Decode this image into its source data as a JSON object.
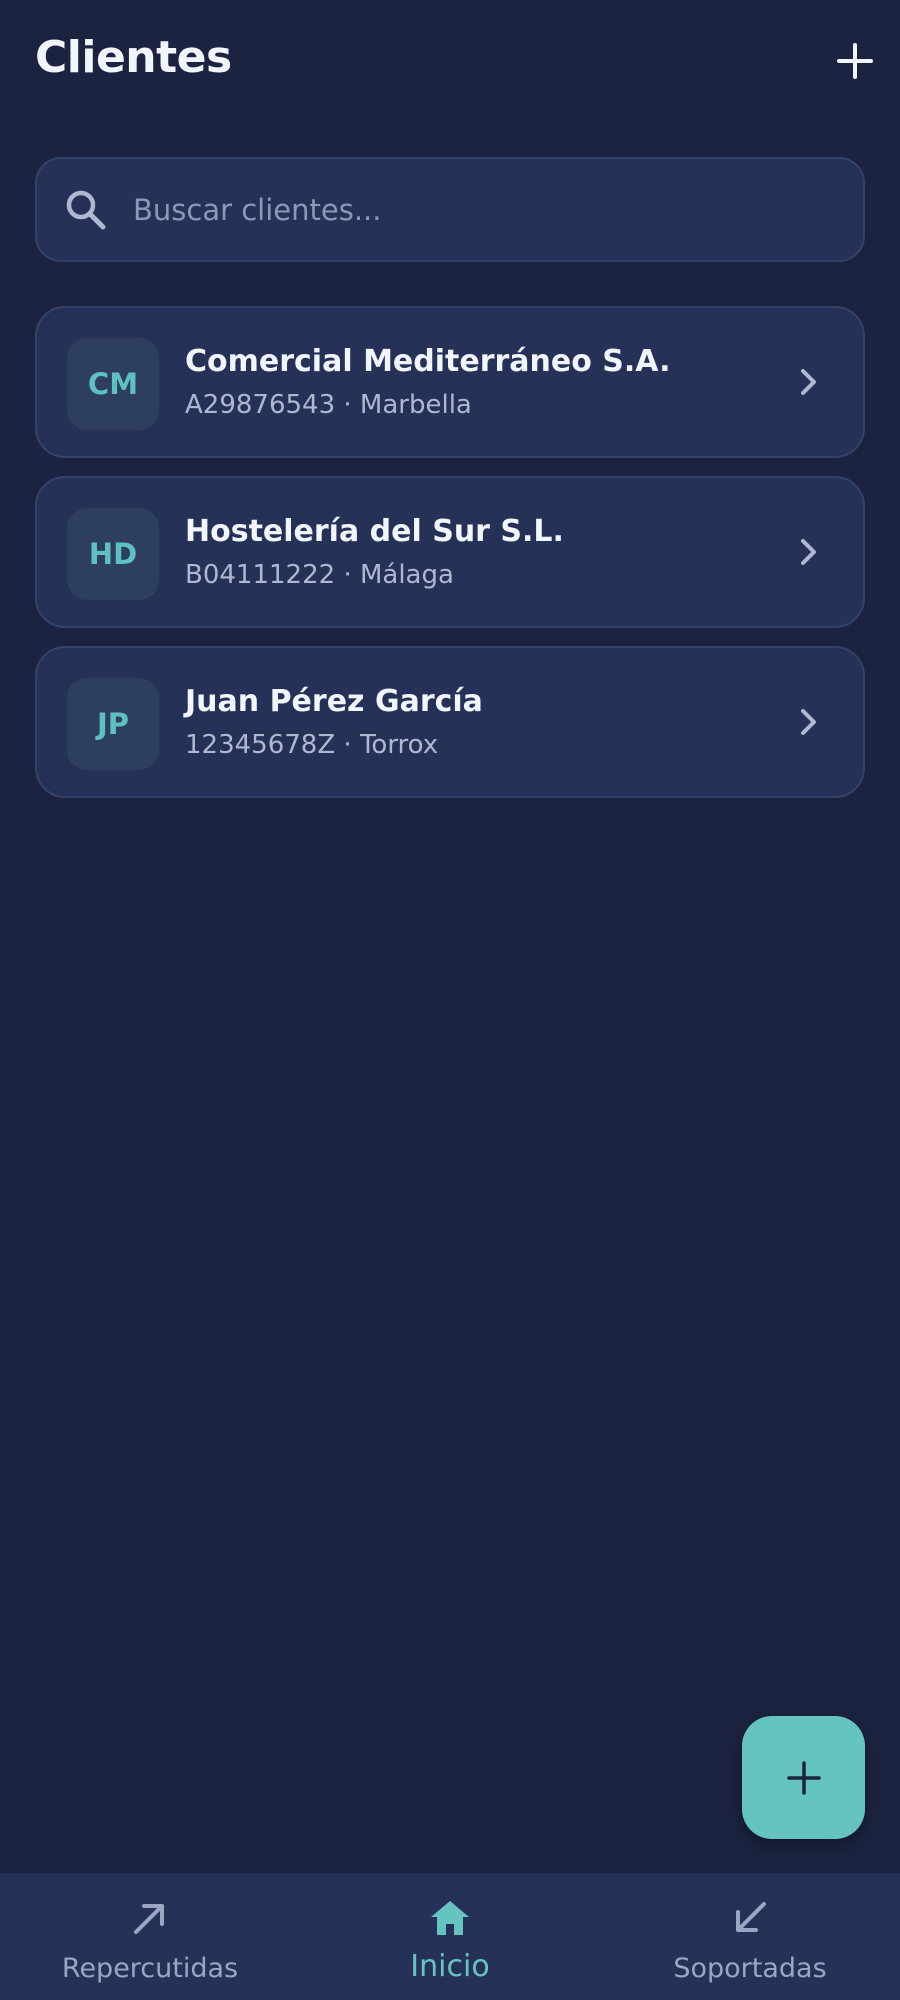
{
  "header": {
    "title": "Clientes",
    "add_icon": "plus-icon"
  },
  "search": {
    "placeholder": "Buscar clientes...",
    "value": "",
    "icon": "search-icon"
  },
  "clients": [
    {
      "initials": "CM",
      "name": "Comercial Mediterráneo S.A.",
      "subtitle": "A29876543 · Marbella"
    },
    {
      "initials": "HD",
      "name": "Hostelería del Sur S.L.",
      "subtitle": "B04111222 · Málaga"
    },
    {
      "initials": "JP",
      "name": "Juan Pérez García",
      "subtitle": "12345678Z · Torrox"
    }
  ],
  "fab": {
    "icon": "plus-icon"
  },
  "bottom_nav": {
    "items": [
      {
        "label": "Repercutidas",
        "icon": "arrow-up-right-icon",
        "active": false
      },
      {
        "label": "Inicio",
        "icon": "home-icon",
        "active": true
      },
      {
        "label": "Soportadas",
        "icon": "arrow-down-left-icon",
        "active": false
      }
    ]
  },
  "colors": {
    "background": "#1c2340",
    "card": "#253157",
    "card_border": "#34426b",
    "accent": "#66c4c0",
    "text_primary": "#f2f5fb",
    "text_secondary": "#aeb8d0",
    "text_muted": "#9aa6c4"
  }
}
